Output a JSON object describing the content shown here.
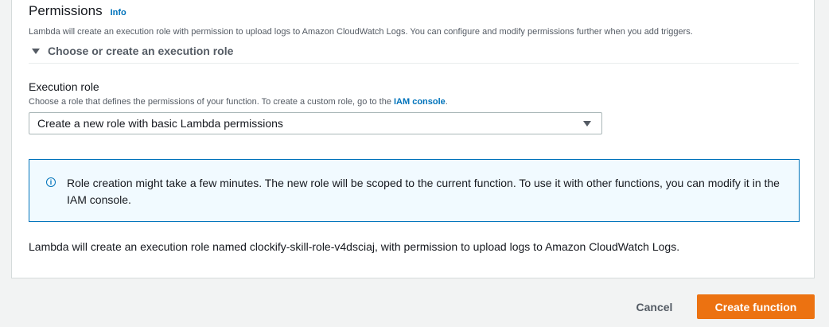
{
  "permissions": {
    "title": "Permissions",
    "info_label": "Info",
    "description": "Lambda will create an execution role with permission to upload logs to Amazon CloudWatch Logs. You can configure and modify permissions further when you add triggers.",
    "expander_label": "Choose or create an execution role",
    "expander_state": "expanded"
  },
  "execution_role": {
    "label": "Execution role",
    "description_prefix": "Choose a role that defines the permissions of your function. To create a custom role, go to the ",
    "link_text": "IAM console",
    "description_suffix": ".",
    "selected_value": "Create a new role with basic Lambda permissions"
  },
  "alert": {
    "icon": "info-circle-icon",
    "text": "Role creation might take a few minutes. The new role will be scoped to the current function. To use it with other functions, you can modify it in the IAM console."
  },
  "result_text": "Lambda will create an execution role named clockify-skill-role-v4dsciaj, with permission to upload logs to Amazon CloudWatch Logs.",
  "footer": {
    "cancel_label": "Cancel",
    "create_label": "Create function"
  },
  "colors": {
    "accent": "#ec7211",
    "link": "#0073bb",
    "info_background": "#f1faff"
  }
}
